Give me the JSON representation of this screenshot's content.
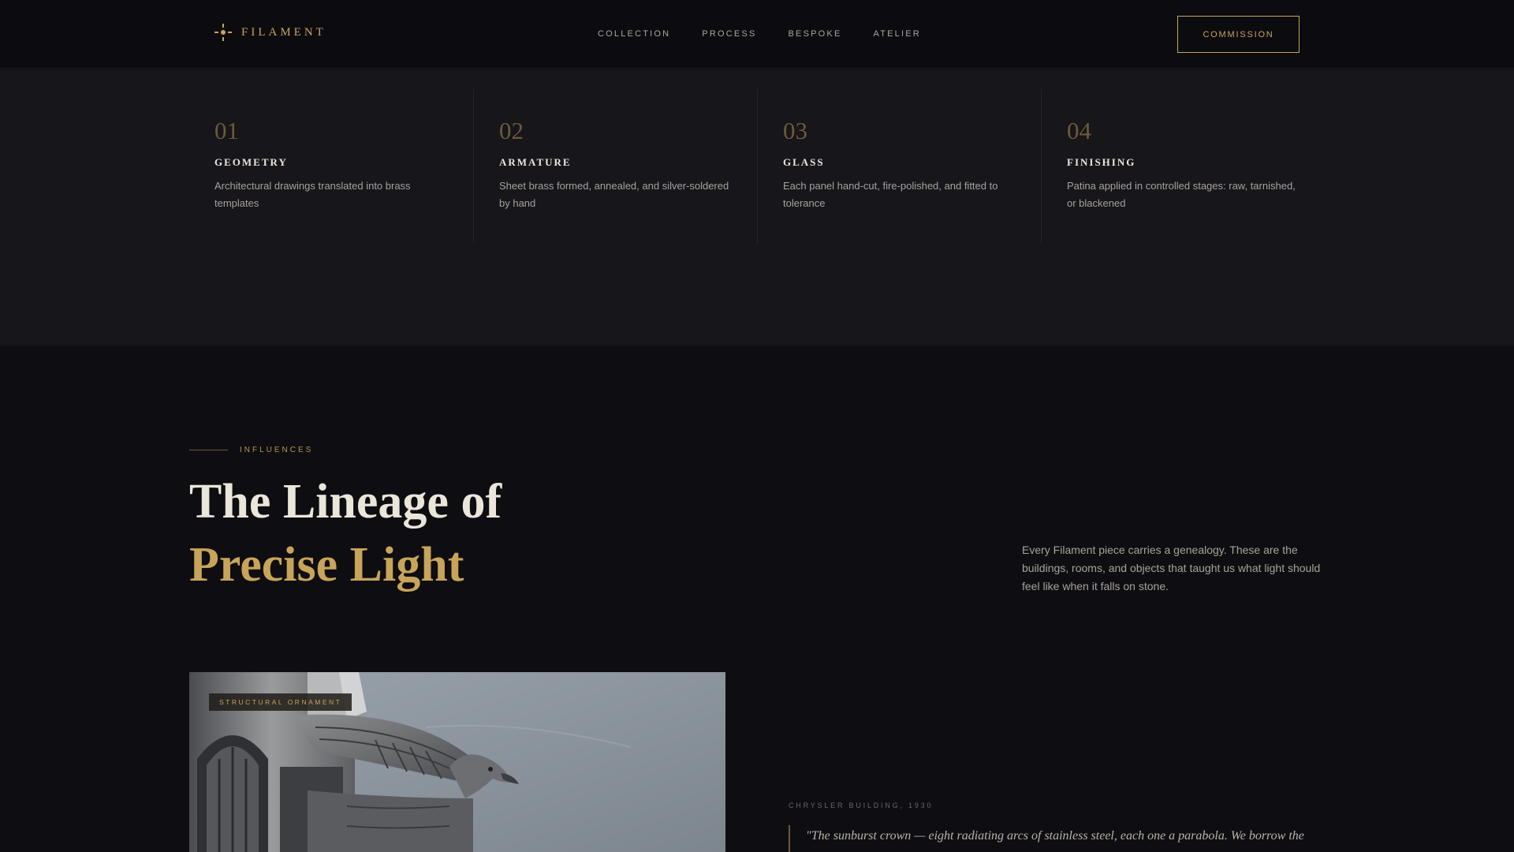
{
  "nav": {
    "brand": "FILAMENT",
    "brand_icon": "sunburst-icon",
    "items": [
      {
        "label": "COLLECTION"
      },
      {
        "label": "PROCESS"
      },
      {
        "label": "BESPOKE"
      },
      {
        "label": "ATELIER"
      }
    ],
    "cta": "COMMISSION"
  },
  "process": {
    "steps": [
      {
        "num": "01",
        "title": "GEOMETRY",
        "desc": "Architectural drawings translated into brass templates"
      },
      {
        "num": "02",
        "title": "ARMATURE",
        "desc": "Sheet brass formed, annealed, and silver-soldered by hand"
      },
      {
        "num": "03",
        "title": "GLASS",
        "desc": "Each panel hand-cut, fire-polished, and fitted to tolerance"
      },
      {
        "num": "04",
        "title": "FINISHING",
        "desc": "Patina applied in controlled stages: raw, tarnished, or blackened"
      }
    ]
  },
  "influences": {
    "eyebrow": "INFLUENCES",
    "heading_line1": "The Lineage of",
    "heading_line2": "Precise Light",
    "intro": "Every Filament piece carries a genealogy. These are the buildings, rooms, and objects that taught us what light should feel like when it falls on stone.",
    "card": {
      "badge": "STRUCTURAL ORNAMENT",
      "image": "eagle-gargoyle-photo"
    },
    "quote": {
      "caption": "CHRYSLER BUILDING, 1930",
      "text": "\"The sunburst crown — eight radiating arcs of stainless steel, each one a parabola. We borrow the"
    }
  },
  "colors": {
    "accent": "#c8a45a",
    "background": "#0e0e12",
    "panel": "#16161b",
    "text": "#ebe6da"
  }
}
